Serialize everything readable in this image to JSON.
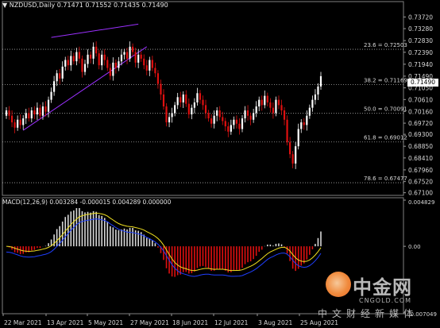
{
  "header": {
    "symbol_label": "NZDUSD,Daily",
    "ohlc": "0.71471  0.71552  0.71435  0.71490"
  },
  "macd_header": {
    "label": "MACD(12,26,9)  0.003284  -0.000015  0.004289  0.000000"
  },
  "current_price_tag": "0.71490",
  "colors": {
    "up_candle": "#ffffff",
    "down_candle": "#e01010",
    "trendline": "#9b30ff",
    "fib_line": "#aaaaaa",
    "signal_line": "#f0e020",
    "macd_line": "#1f3fff",
    "grid": "#333333"
  },
  "watermark": {
    "brand": "中金网",
    "domain": "CNGOLD.COM",
    "tagline": "中文财经新媒体"
  },
  "chart_data": [
    {
      "type": "candlestick",
      "title": "NZDUSD,Daily",
      "ylim": [
        0.67,
        0.74
      ],
      "y_ticks": [
        "0.73720",
        "0.73280",
        "0.72830",
        "0.72390",
        "0.71940",
        "0.71490",
        "0.71050",
        "0.70610",
        "0.70160",
        "0.69720",
        "0.69300",
        "0.68850",
        "0.68410",
        "0.67960",
        "0.67520",
        "0.67100"
      ],
      "x_ticks": [
        "22 Mar 2021",
        "13 Apr 2021",
        "5 May 2021",
        "27 May 2021",
        "18 Jun 2021",
        "12 Jul 2021",
        "3 Aug 2021",
        "25 Aug 2021"
      ],
      "fib_levels": [
        {
          "label": "23.6 = 0.72503",
          "value": 0.72503
        },
        {
          "label": "38.2 = 0.71169",
          "value": 0.71169
        },
        {
          "label": "50.0 = 0.70091",
          "value": 0.70091
        },
        {
          "label": "61.8 = 0.69012",
          "value": 0.69012
        },
        {
          "label": "78.6 = 0.67477",
          "value": 0.67477
        }
      ],
      "closes": [
        0.702,
        0.7,
        0.6975,
        0.6955,
        0.6985,
        0.6965,
        0.699,
        0.701,
        0.699,
        0.702,
        0.7005,
        0.703,
        0.7,
        0.7035,
        0.7015,
        0.706,
        0.709,
        0.713,
        0.716,
        0.714,
        0.7185,
        0.721,
        0.719,
        0.7225,
        0.7205,
        0.724,
        0.7215,
        0.7165,
        0.7195,
        0.723,
        0.7215,
        0.726,
        0.7235,
        0.719,
        0.723,
        0.721,
        0.718,
        0.715,
        0.72,
        0.718,
        0.7205,
        0.723,
        0.724,
        0.7215,
        0.726,
        0.724,
        0.72,
        0.723,
        0.7215,
        0.719,
        0.717,
        0.721,
        0.718,
        0.716,
        0.712,
        0.708,
        0.7035,
        0.6975,
        0.6995,
        0.701,
        0.704,
        0.707,
        0.705,
        0.708,
        0.7045,
        0.7005,
        0.703,
        0.705,
        0.7085,
        0.706,
        0.704,
        0.701,
        0.699,
        0.697,
        0.7,
        0.702,
        0.6995,
        0.698,
        0.696,
        0.694,
        0.6965,
        0.6985,
        0.697,
        0.695,
        0.699,
        0.702,
        0.7,
        0.6985,
        0.701,
        0.7035,
        0.706,
        0.704,
        0.7075,
        0.705,
        0.703,
        0.701,
        0.706,
        0.704,
        0.702,
        0.6985,
        0.69,
        0.6855,
        0.682,
        0.6885,
        0.695,
        0.6975,
        0.6965,
        0.7,
        0.703,
        0.706,
        0.708,
        0.711,
        0.7149
      ],
      "current": 0.7149
    },
    {
      "type": "bar+line",
      "title": "MACD(12,26,9)",
      "ylim": [
        -0.007049,
        0.004829
      ],
      "y_ticks": [
        "0.004829",
        "0.00",
        "-0.007049"
      ],
      "values": {
        "main": 0.003284,
        "signal": -1.5e-05,
        "histogram": 0.004289
      }
    }
  ]
}
